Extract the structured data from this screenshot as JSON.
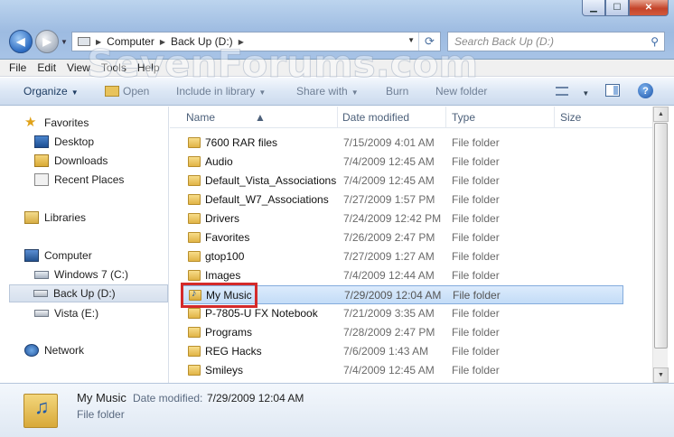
{
  "window": {
    "caption_min": "▁",
    "caption_max": "☐",
    "caption_close": "✕"
  },
  "watermark": "SevenForums.com",
  "address": {
    "crumbs": [
      "Computer",
      "Back Up (D:)"
    ],
    "search_placeholder": "Search Back Up (D:)"
  },
  "menu": {
    "items": [
      "File",
      "Edit",
      "View",
      "Tools",
      "Help"
    ]
  },
  "toolbar": {
    "organize": "Organize",
    "open": "Open",
    "include_in_library": "Include in library",
    "share_with": "Share with",
    "burn": "Burn",
    "new_folder": "New folder"
  },
  "nav": {
    "favorites": "Favorites",
    "desktop": "Desktop",
    "downloads": "Downloads",
    "recent_places": "Recent Places",
    "libraries": "Libraries",
    "computer": "Computer",
    "windows7": "Windows 7 (C:)",
    "backup": "Back Up (D:)",
    "vista": "Vista (E:)",
    "network": "Network"
  },
  "columns": {
    "name": "Name",
    "date_modified": "Date modified",
    "type": "Type",
    "size": "Size"
  },
  "files": [
    {
      "name": "7600 RAR files",
      "date": "7/15/2009 4:01 AM",
      "type": "File folder"
    },
    {
      "name": "Audio",
      "date": "7/4/2009 12:45 AM",
      "type": "File folder"
    },
    {
      "name": "Default_Vista_Associations",
      "date": "7/4/2009 12:45 AM",
      "type": "File folder"
    },
    {
      "name": "Default_W7_Associations",
      "date": "7/27/2009 1:57 PM",
      "type": "File folder"
    },
    {
      "name": "Drivers",
      "date": "7/24/2009 12:42 PM",
      "type": "File folder"
    },
    {
      "name": "Favorites",
      "date": "7/26/2009 2:47 PM",
      "type": "File folder"
    },
    {
      "name": "gtop100",
      "date": "7/27/2009 1:27 AM",
      "type": "File folder"
    },
    {
      "name": "Images",
      "date": "7/4/2009 12:44 AM",
      "type": "File folder"
    },
    {
      "name": "My Music",
      "date": "7/29/2009 12:04 AM",
      "type": "File folder"
    },
    {
      "name": "P-7805-U FX Notebook",
      "date": "7/21/2009 3:35 AM",
      "type": "File folder"
    },
    {
      "name": "Programs",
      "date": "7/28/2009 2:47 PM",
      "type": "File folder"
    },
    {
      "name": "REG Hacks",
      "date": "7/6/2009 1:43 AM",
      "type": "File folder"
    },
    {
      "name": "Smileys",
      "date": "7/4/2009 12:45 AM",
      "type": "File folder"
    }
  ],
  "details": {
    "name": "My Music",
    "date_label": "Date modified:",
    "date_value": "7/29/2009 12:04 AM",
    "type": "File folder"
  }
}
